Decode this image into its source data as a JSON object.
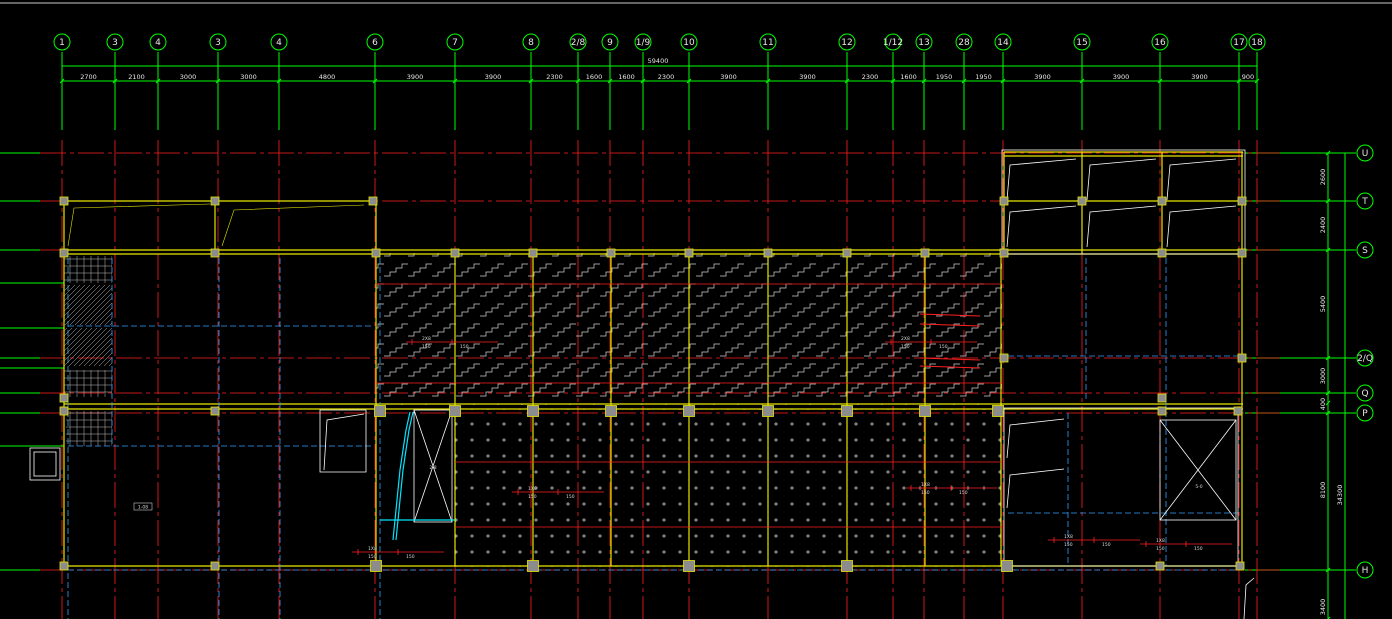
{
  "drawing": {
    "background": "#000000",
    "colors": {
      "axis_green": "#00ff00",
      "gridline_red": "#ff2020",
      "beam_yellow": "#e6e600",
      "hidden_cyan": "#30a0ff",
      "outline_white": "#ffffff",
      "column_fill": "#8c8c8c",
      "rebar_cyan": "#00e5ff",
      "text_white": "#e8e8e8"
    },
    "overall_dimension": "59400",
    "column_axes": [
      "1",
      "3",
      "4",
      "3",
      "4",
      "6",
      "7",
      "8",
      "2/8",
      "9",
      "1/9",
      "10",
      "11",
      "12",
      "1/12",
      "13",
      "28",
      "14",
      "15",
      "16",
      "17",
      "18"
    ],
    "span_dimensions": [
      "2700",
      "2100",
      "3000",
      "3000",
      "4800",
      "3900",
      "3900",
      "2300",
      "1600",
      "1600",
      "2300",
      "3900",
      "3900",
      "2300",
      "1600",
      "1950",
      "1950",
      "3900",
      "3900",
      "3900",
      "900"
    ],
    "row_axes": [
      "U",
      "T",
      "S",
      "2/Q",
      "Q",
      "P",
      "H"
    ],
    "row_dimensions": [
      "2600",
      "2400",
      "5400",
      "3000",
      "400",
      "8100",
      "34300",
      "3400"
    ],
    "cell_notes": {
      "hatched_row": [
        "2X8",
        "150",
        "2X8",
        "150"
      ],
      "cross_row": [
        "1X8",
        "150",
        "1X8",
        "150"
      ],
      "room_label": "1-08",
      "stair_label": "2-8",
      "lift_label": "5-0"
    }
  }
}
